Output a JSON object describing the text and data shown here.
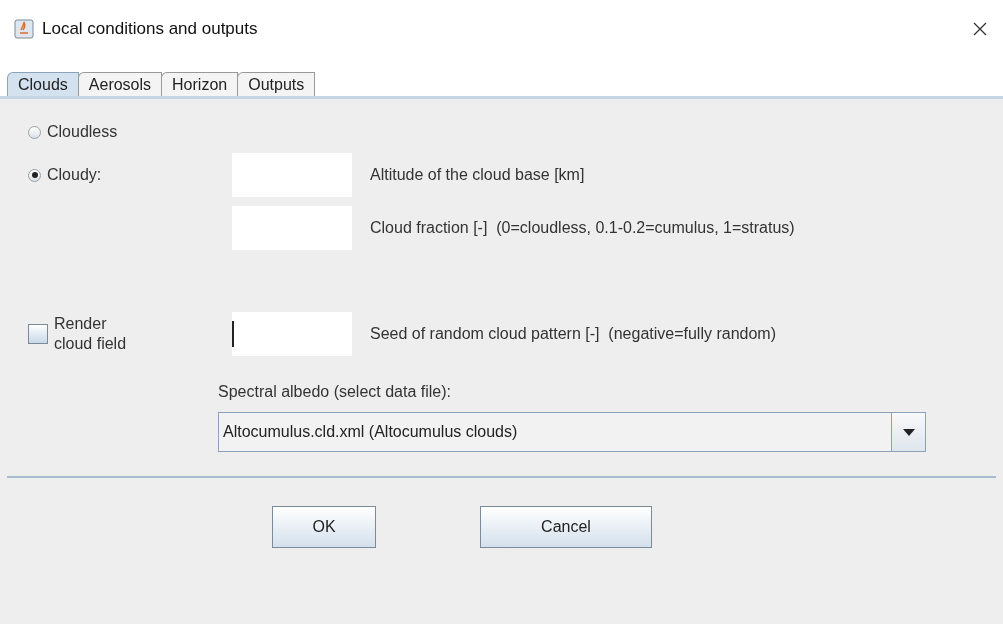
{
  "window": {
    "title": "Local conditions and outputs"
  },
  "tabs": [
    {
      "label": "Clouds",
      "selected": true
    },
    {
      "label": "Aerosols",
      "selected": false
    },
    {
      "label": "Horizon",
      "selected": false
    },
    {
      "label": "Outputs",
      "selected": false
    }
  ],
  "cloud_mode": [
    {
      "label": "Cloudless",
      "selected": false
    },
    {
      "label": "Cloudy:",
      "selected": true
    }
  ],
  "cloudy_fields": [
    {
      "label": "Altitude of the cloud base [km]"
    },
    {
      "label": "Cloud fraction [-]  (0=cloudless, 0.1-0.2=cumulus, 1=stratus)"
    }
  ],
  "render": {
    "label": "Render cloud field",
    "checked": false
  },
  "seed_field": {
    "label": "Seed of random cloud pattern [-]  (negative=fully random)",
    "focused": true
  },
  "albedo": {
    "label": "Spectral albedo (select data file):",
    "value": "Altocumulus.cld.xml (Altocumulus clouds)"
  },
  "buttons": [
    "OK",
    "Cancel"
  ]
}
